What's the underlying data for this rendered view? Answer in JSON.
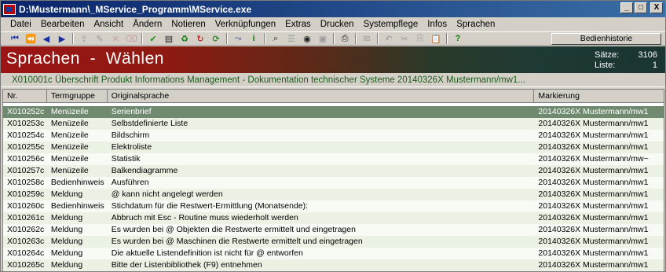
{
  "window": {
    "title": "D:\\Mustermann\\_MService_Programm\\MService.exe",
    "buttons": {
      "minimize": "_",
      "maximize": "□",
      "close": "X"
    }
  },
  "menu": [
    "Datei",
    "Bearbeiten",
    "Ansicht",
    "Ändern",
    "Notieren",
    "Verknüpfungen",
    "Extras",
    "Drucken",
    "Systempflege",
    "Infos",
    "Sprachen"
  ],
  "toolbar": {
    "icons": [
      {
        "name": "first-record-icon",
        "glyph": "⏮",
        "color": "#1a2fa0",
        "enabled": true
      },
      {
        "name": "previous-page-icon",
        "glyph": "⏪",
        "color": "#1a2fa0",
        "enabled": true
      },
      {
        "name": "previous-record-icon",
        "glyph": "◀",
        "color": "#1a2fa0",
        "enabled": true
      },
      {
        "name": "next-record-icon",
        "glyph": "▶",
        "color": "#1a2fa0",
        "enabled": true
      },
      {
        "name": "sep",
        "glyph": "",
        "color": "",
        "enabled": false
      },
      {
        "name": "export-icon",
        "glyph": "⇪",
        "color": "#9a9a9a",
        "enabled": false
      },
      {
        "name": "edit-icon",
        "glyph": "✎",
        "color": "#9a9a9a",
        "enabled": false
      },
      {
        "name": "delete-icon",
        "glyph": "✕",
        "color": "#c8a0a0",
        "enabled": false
      },
      {
        "name": "erase-icon",
        "glyph": "⌫",
        "color": "#c8a0a0",
        "enabled": false
      },
      {
        "name": "sep",
        "glyph": "",
        "color": "",
        "enabled": false
      },
      {
        "name": "checkmark-icon",
        "glyph": "✓",
        "color": "#0a8a0a",
        "enabled": true
      },
      {
        "name": "form-icon",
        "glyph": "▤",
        "color": "#202020",
        "enabled": true
      },
      {
        "name": "recycle-icon",
        "glyph": "♻",
        "color": "#0a7a0a",
        "enabled": true
      },
      {
        "name": "redo-red-icon",
        "glyph": "↻",
        "color": "#c00000",
        "enabled": true
      },
      {
        "name": "refresh-green-icon",
        "glyph": "⟳",
        "color": "#0a7a0a",
        "enabled": true
      },
      {
        "name": "sep",
        "glyph": "",
        "color": "",
        "enabled": false
      },
      {
        "name": "branch-icon",
        "glyph": "⤳",
        "color": "#1a2fa0",
        "enabled": true
      },
      {
        "name": "info-icon",
        "glyph": "i",
        "color": "#0a7a0a",
        "enabled": true
      },
      {
        "name": "sep",
        "glyph": "",
        "color": "",
        "enabled": false
      },
      {
        "name": "binoculars-icon",
        "glyph": "⌕",
        "color": "#202020",
        "enabled": true
      },
      {
        "name": "list-icon",
        "glyph": "☰",
        "color": "#9a9a9a",
        "enabled": false
      },
      {
        "name": "view-icon",
        "glyph": "◉",
        "color": "#202020",
        "enabled": true
      },
      {
        "name": "image-icon",
        "glyph": "▣",
        "color": "#9a9a9a",
        "enabled": false
      },
      {
        "name": "sep",
        "glyph": "",
        "color": "",
        "enabled": false
      },
      {
        "name": "print-icon",
        "glyph": "⎙",
        "color": "#202020",
        "enabled": true
      },
      {
        "name": "sep",
        "glyph": "",
        "color": "",
        "enabled": false
      },
      {
        "name": "mail-icon",
        "glyph": "✉",
        "color": "#9a9a9a",
        "enabled": false
      },
      {
        "name": "sep",
        "glyph": "",
        "color": "",
        "enabled": false
      },
      {
        "name": "undo-icon",
        "glyph": "↶",
        "color": "#9a9a9a",
        "enabled": false
      },
      {
        "name": "cut-icon",
        "glyph": "✂",
        "color": "#9a9a9a",
        "enabled": false
      },
      {
        "name": "copy-icon",
        "glyph": "⎘",
        "color": "#9a9a9a",
        "enabled": false
      },
      {
        "name": "paste-icon",
        "glyph": "📋",
        "color": "#9a9a9a",
        "enabled": false
      },
      {
        "name": "sep",
        "glyph": "",
        "color": "",
        "enabled": false
      },
      {
        "name": "help-icon",
        "glyph": "?",
        "color": "#0a7a0a",
        "enabled": true
      }
    ],
    "history_label": "Bedienhistorie"
  },
  "banner": {
    "title": "Sprachen  -  Wählen",
    "records_label": "Sätze:",
    "records_value": "3106",
    "list_label": "Liste:",
    "list_value": "1"
  },
  "subtitle": "X010001c  Überschrift  Produkt Informations Management  -  Dokumentation technischer Systeme  20140326X Mustermann/mw1...",
  "table": {
    "columns": [
      "Nr.",
      "Termgruppe",
      "Originalsprache",
      "Markierung"
    ],
    "rows": [
      {
        "nr": "X010252c",
        "group": "Menüzeile",
        "text": "Serienbrief",
        "mark": "20140326X Mustermann/mw1",
        "selected": true
      },
      {
        "nr": "X010253c",
        "group": "Menüzeile",
        "text": "Selbstdefinierte Liste",
        "mark": "20140326X Mustermann/mw1",
        "selected": false
      },
      {
        "nr": "X010254c",
        "group": "Menüzeile",
        "text": "Bildschirm",
        "mark": "20140326X Mustermann/mw1",
        "selected": false
      },
      {
        "nr": "X010255c",
        "group": "Menüzeile",
        "text": "Elektroliste",
        "mark": "20140326X Mustermann/mw1",
        "selected": false
      },
      {
        "nr": "X010256c",
        "group": "Menüzeile",
        "text": "Statistik",
        "mark": "20140326X Mustermann/mw~",
        "selected": false
      },
      {
        "nr": "X010257c",
        "group": "Menüzeile",
        "text": "Balkendiagramme",
        "mark": "20140326X Mustermann/mw1",
        "selected": false
      },
      {
        "nr": "X010258c",
        "group": "Bedienhinweis",
        "text": "Ausführen",
        "mark": "20140326X Mustermann/mw1",
        "selected": false
      },
      {
        "nr": "X010259c",
        "group": "Meldung",
        "text": "@ kann nicht angelegt werden",
        "mark": "20140326X Mustermann/mw1",
        "selected": false
      },
      {
        "nr": "X010260c",
        "group": "Bedienhinweis",
        "text": "Stichdatum für die Restwert-Ermittlung (Monatsende):",
        "mark": "20140326X Mustermann/mw1",
        "selected": false
      },
      {
        "nr": "X010261c",
        "group": "Meldung",
        "text": "Abbruch mit Esc - Routine muss wiederholt werden",
        "mark": "20140326X Mustermann/mw1",
        "selected": false
      },
      {
        "nr": "X010262c",
        "group": "Meldung",
        "text": "Es wurden bei @ Objekten die Restwerte ermittelt und eingetragen",
        "mark": "20140326X Mustermann/mw1",
        "selected": false
      },
      {
        "nr": "X010263c",
        "group": "Meldung",
        "text": "Es wurden bei @ Maschinen die Restwerte ermittelt und eingetragen",
        "mark": "20140326X Mustermann/mw1",
        "selected": false
      },
      {
        "nr": "X010264c",
        "group": "Meldung",
        "text": "Die aktuelle Listendefinition ist nicht für @ entworfen",
        "mark": "20140326X Mustermann/mw1",
        "selected": false
      },
      {
        "nr": "X010265c",
        "group": "Meldung",
        "text": "Bitte der Listenbibliothek (F9) entnehmen",
        "mark": "20140326X Mustermann/mw1",
        "selected": false
      }
    ]
  }
}
